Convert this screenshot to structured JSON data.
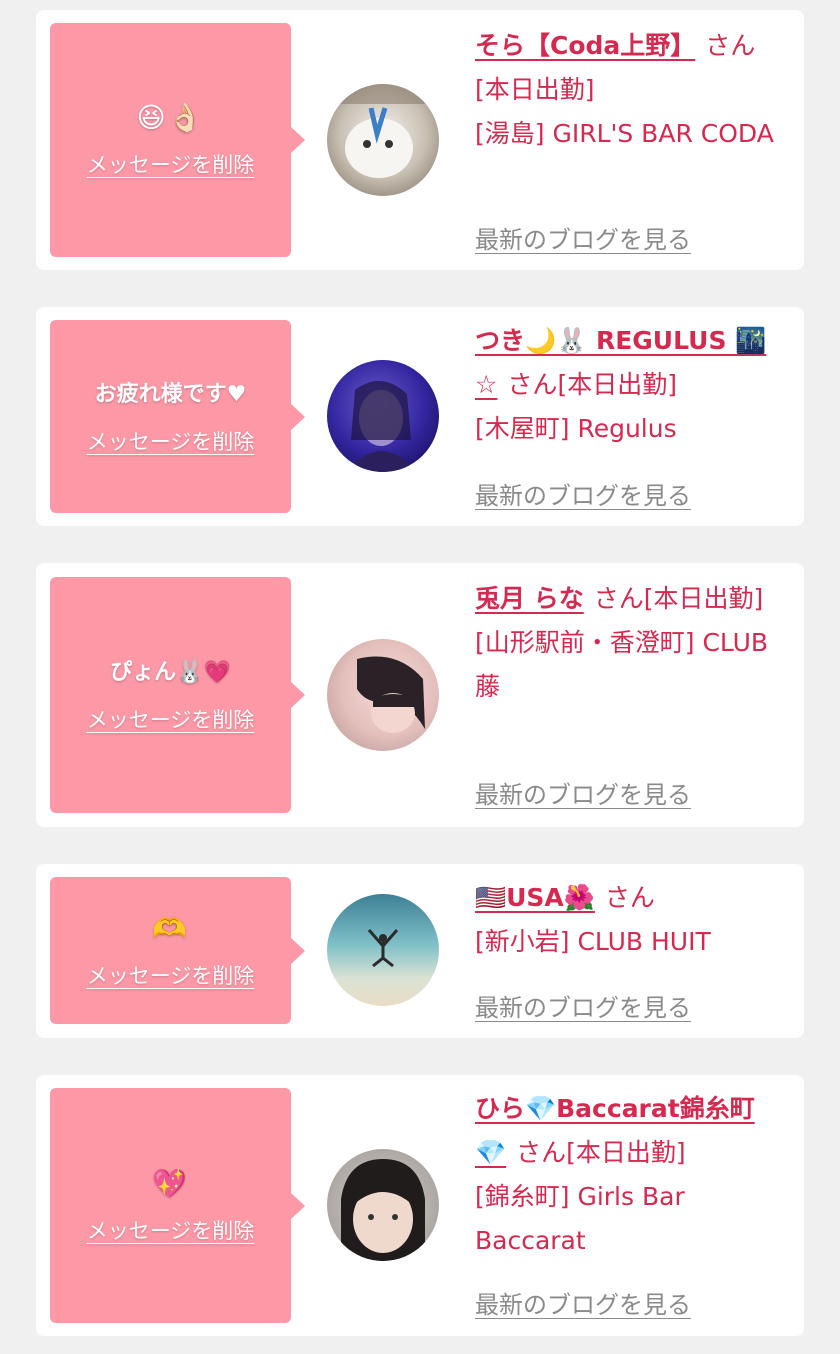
{
  "delete_label": "メッセージを削除",
  "blog_label": "最新のブログを見る",
  "colors": {
    "accent": "#d5294f",
    "bubble": "#fd98a7",
    "card": "#ffffff",
    "background": "#f0f0f0",
    "link_gray": "#8a8a8a"
  },
  "messages": [
    {
      "message": "😆👌🏻",
      "cast_name": "そら【Coda上野】",
      "san": "さん",
      "status": "[本日出勤]",
      "shop": "[湯島] GIRL'S BAR CODA"
    },
    {
      "message": "お疲れ様です♥",
      "cast_name": "つき🌙🐰 REGULUS 🌃☆",
      "san": "さん",
      "status": "[本日出勤]",
      "shop": "[木屋町] Regulus"
    },
    {
      "message": "ぴょん🐰💗",
      "cast_name": "兎月 らな",
      "san": "さん",
      "status": "[本日出勤]",
      "shop": "[山形駅前・香澄町] CLUB 藤"
    },
    {
      "message": "🫶",
      "cast_name": "🇺🇸USA🌺",
      "san": "さん",
      "status": "",
      "shop": "[新小岩] CLUB HUIT"
    },
    {
      "message": "💖",
      "cast_name": "ひら💎Baccarat錦糸町💎",
      "san": "さん",
      "status": "[本日出勤]",
      "shop": "[錦糸町] Girls Bar Baccarat"
    }
  ]
}
